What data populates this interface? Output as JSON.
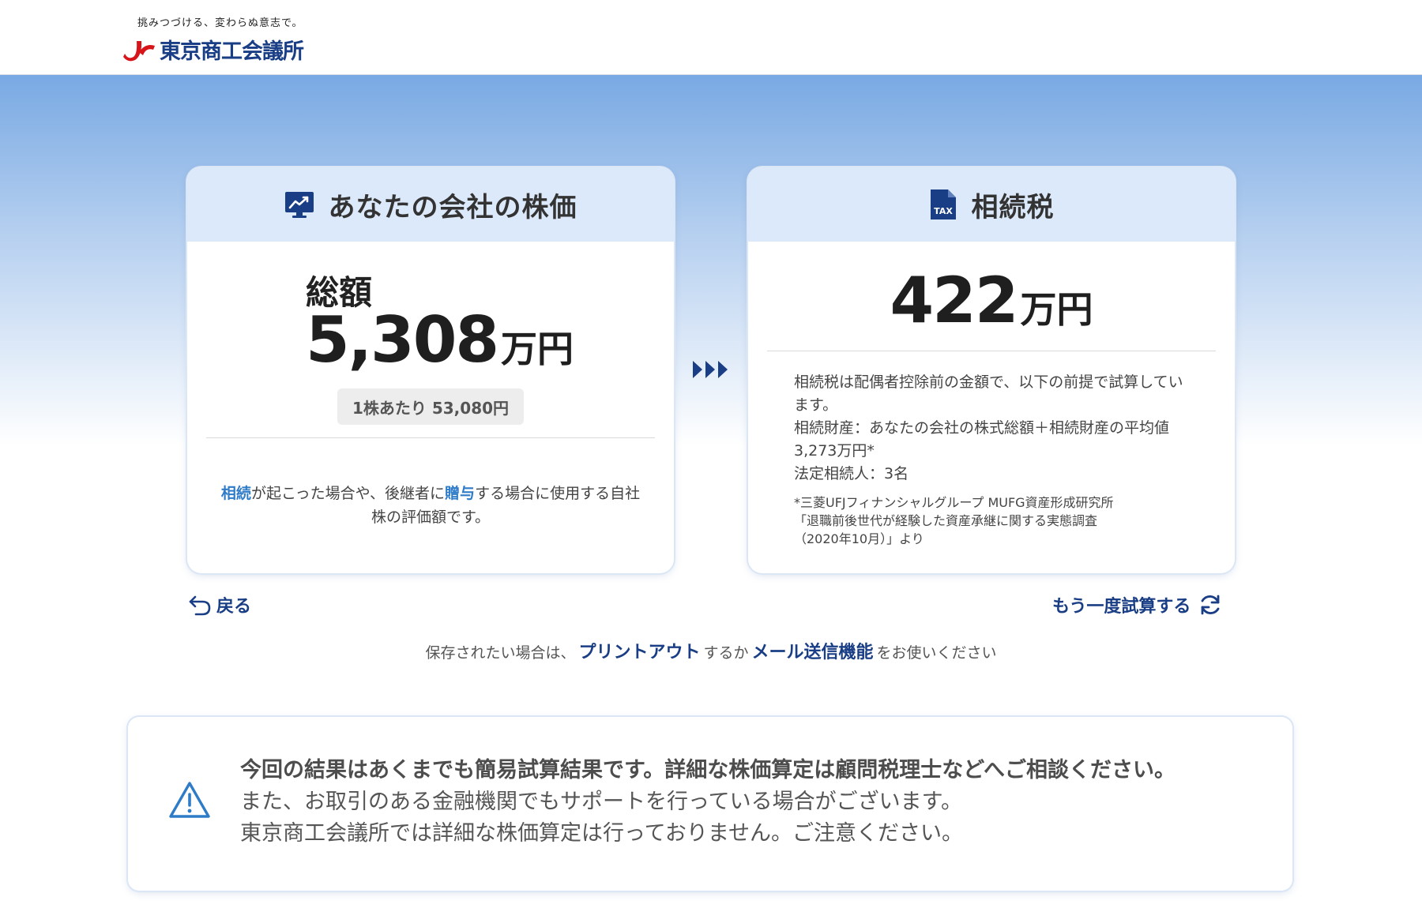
{
  "header": {
    "tagline": "挑みつづける、変わらぬ意志で。",
    "org_name": "東京商工会議所"
  },
  "stock_card": {
    "title": "あなたの会社の株価",
    "icon": "chart-monitor-icon",
    "total_label": "総額",
    "total_value": "5,308",
    "total_unit": "万円",
    "per_share": "1株あたり 53,080円",
    "desc_part1": "相続",
    "desc_part2": "が起こった場合や、後継者に",
    "desc_part3": "贈与",
    "desc_part4": "する場合に使用する自社株の評価額です。"
  },
  "tax_card": {
    "title": "相続税",
    "icon": "tax-document-icon",
    "icon_label": "TAX",
    "value": "422",
    "unit": "万円",
    "desc_line1": "相続税は配偶者控除前の金額で、以下の前提で試算しています。",
    "desc_line2": "相続財産：あなたの会社の株式総額＋相続財産の平均値3,273万円*",
    "desc_line3": "法定相続人：3名",
    "footnote_line1": "*三菱UFJフィナンシャルグループ MUFG資産形成研究所",
    "footnote_line2": "「退職前後世代が経験した資産承継に関する実態調査",
    "footnote_line3": "（2020年10月）」より"
  },
  "nav": {
    "back_label": "戻る",
    "retry_label": "もう一度試算する"
  },
  "save_note": {
    "prefix": "保存されたい場合は、",
    "print_link": "プリントアウト",
    "middle": "するか",
    "mail_link": "メール送信機能",
    "suffix": "をお使いください"
  },
  "notice": {
    "line1": "今回の結果はあくまでも簡易試算結果です。詳細な株価算定は顧問税理士などへご相談ください。",
    "line2": "また、お取引のある金融機関でもサポートを行っている場合がございます。",
    "line3": "東京商工会議所では詳細な株価算定は行っておりません。ご注意ください。"
  },
  "colors": {
    "brand_navy": "#1a3e85",
    "brand_red": "#d7141a",
    "link_blue": "#2e7bc8",
    "card_header_bg": "#dce9fb"
  }
}
